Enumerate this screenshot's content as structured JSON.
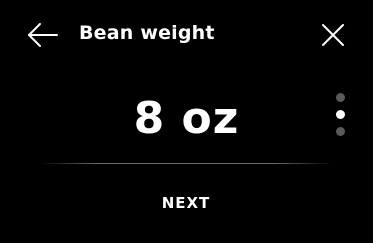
{
  "header": {
    "title": "Bean weight",
    "back_icon": "arrow-left-icon",
    "close_icon": "close-icon"
  },
  "selector": {
    "value": "8 oz",
    "page_indicator": {
      "total": 3,
      "active": 2
    }
  },
  "footer": {
    "next_label": "NEXT"
  },
  "colors": {
    "background": "#000000",
    "text": "#ffffff",
    "inactive_dot": "#5a5a5a",
    "divider": "#787878"
  }
}
